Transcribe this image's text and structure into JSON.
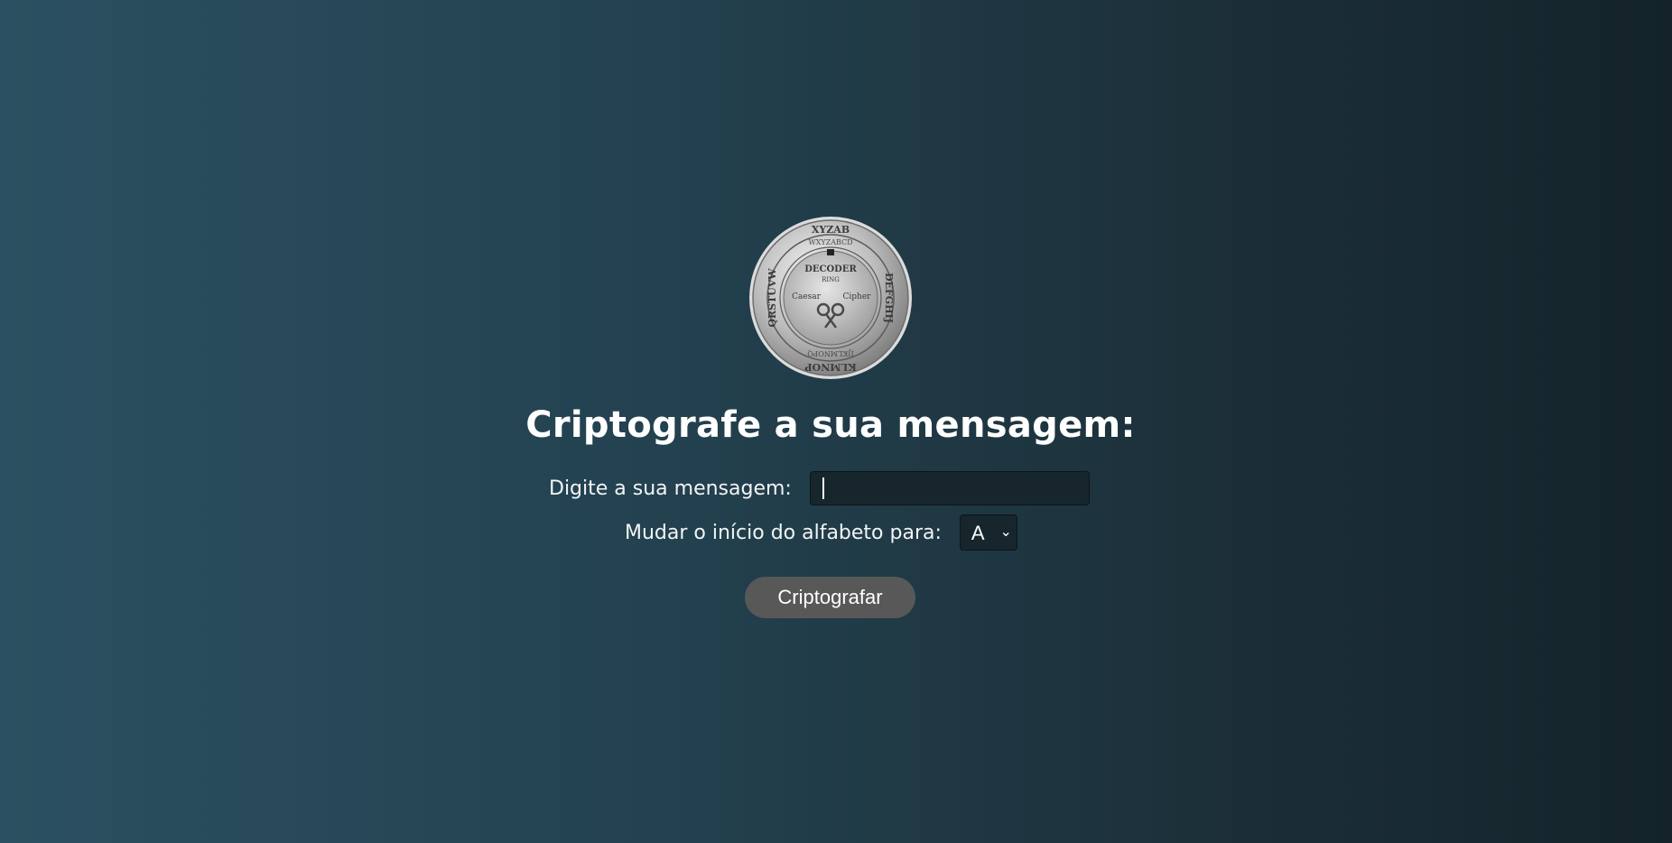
{
  "colors": {
    "background_left": "#2b5061",
    "background_right": "#14232a",
    "button_bg": "#585858",
    "input_bg": "#17262d"
  },
  "logo": {
    "icon": "caesar-cipher-decoder-ring-icon",
    "inner_text_top": "DECODER",
    "inner_text_ring": "RING",
    "inner_text_left": "Caesar",
    "inner_text_right": "Cipher"
  },
  "header": {
    "title": "Criptografe a sua mensagem:"
  },
  "form": {
    "message_label": "Digite a sua mensagem:",
    "message_value": "",
    "shift_label": "Mudar o início do alfabeto para:",
    "shift_selected": "A",
    "submit_label": "Criptografar"
  }
}
